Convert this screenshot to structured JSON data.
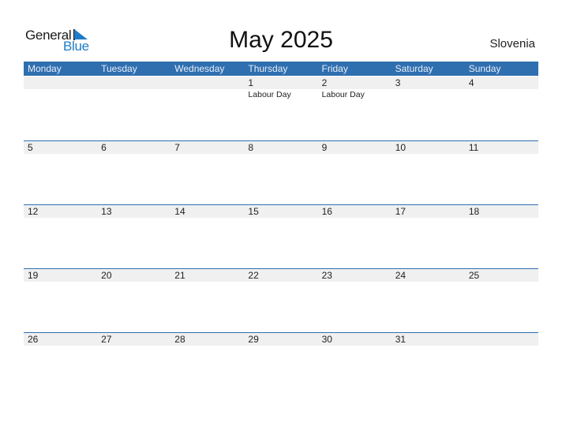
{
  "logo": {
    "word1": "General",
    "word2": "Blue",
    "brand_color": "#1e7bc6"
  },
  "title": "May 2025",
  "country": "Slovenia",
  "colors": {
    "header_bg": "#2f6fb0",
    "day_strip": "#f0f0f0"
  },
  "weekdays": [
    "Monday",
    "Tuesday",
    "Wednesday",
    "Thursday",
    "Friday",
    "Saturday",
    "Sunday"
  ],
  "weeks": [
    [
      {
        "day": "",
        "holiday": ""
      },
      {
        "day": "",
        "holiday": ""
      },
      {
        "day": "",
        "holiday": ""
      },
      {
        "day": "1",
        "holiday": "Labour Day"
      },
      {
        "day": "2",
        "holiday": "Labour Day"
      },
      {
        "day": "3",
        "holiday": ""
      },
      {
        "day": "4",
        "holiday": ""
      }
    ],
    [
      {
        "day": "5",
        "holiday": ""
      },
      {
        "day": "6",
        "holiday": ""
      },
      {
        "day": "7",
        "holiday": ""
      },
      {
        "day": "8",
        "holiday": ""
      },
      {
        "day": "9",
        "holiday": ""
      },
      {
        "day": "10",
        "holiday": ""
      },
      {
        "day": "11",
        "holiday": ""
      }
    ],
    [
      {
        "day": "12",
        "holiday": ""
      },
      {
        "day": "13",
        "holiday": ""
      },
      {
        "day": "14",
        "holiday": ""
      },
      {
        "day": "15",
        "holiday": ""
      },
      {
        "day": "16",
        "holiday": ""
      },
      {
        "day": "17",
        "holiday": ""
      },
      {
        "day": "18",
        "holiday": ""
      }
    ],
    [
      {
        "day": "19",
        "holiday": ""
      },
      {
        "day": "20",
        "holiday": ""
      },
      {
        "day": "21",
        "holiday": ""
      },
      {
        "day": "22",
        "holiday": ""
      },
      {
        "day": "23",
        "holiday": ""
      },
      {
        "day": "24",
        "holiday": ""
      },
      {
        "day": "25",
        "holiday": ""
      }
    ],
    [
      {
        "day": "26",
        "holiday": ""
      },
      {
        "day": "27",
        "holiday": ""
      },
      {
        "day": "28",
        "holiday": ""
      },
      {
        "day": "29",
        "holiday": ""
      },
      {
        "day": "30",
        "holiday": ""
      },
      {
        "day": "31",
        "holiday": ""
      },
      {
        "day": "",
        "holiday": ""
      }
    ]
  ]
}
